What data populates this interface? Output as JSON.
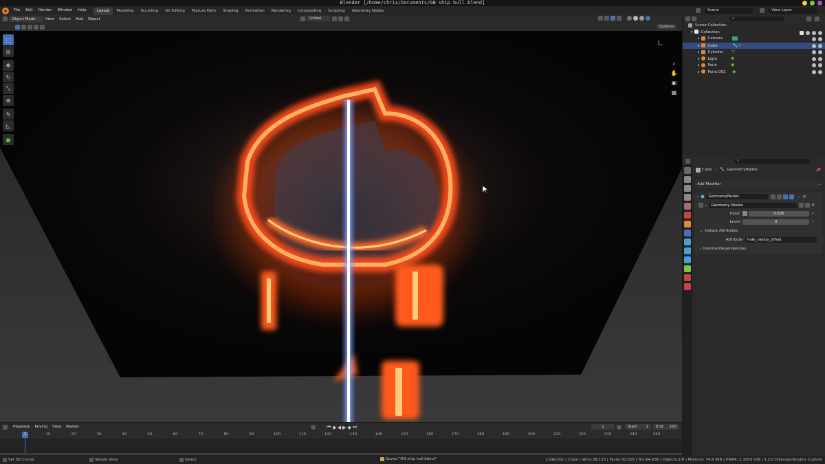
{
  "window": {
    "title": "Blender [/home/chris/Documents/GN ship hull.blend]"
  },
  "menu": {
    "items": [
      "File",
      "Edit",
      "Render",
      "Window",
      "Help"
    ]
  },
  "workspaces": [
    "Layout",
    "Modeling",
    "Sculpting",
    "UV Editing",
    "Texture Paint",
    "Shading",
    "Animation",
    "Rendering",
    "Compositing",
    "Scripting",
    "Geometry Nodes"
  ],
  "workspace_active": "Layout",
  "top_right": {
    "scene": "Scene",
    "view_layer": "View Layer"
  },
  "viewport_header": {
    "mode": "Object Mode",
    "menus": [
      "View",
      "Select",
      "Add",
      "Object"
    ],
    "orientation": "Global",
    "options": "Options"
  },
  "timeline": {
    "menus": [
      "Playback",
      "Keying",
      "View",
      "Marker"
    ],
    "current_frame": "1",
    "start_label": "Start",
    "start": "1",
    "end_label": "End",
    "end": "250",
    "playhead": "1",
    "ticks": [
      "10",
      "20",
      "30",
      "40",
      "50",
      "60",
      "70",
      "80",
      "90",
      "100",
      "110",
      "120",
      "130",
      "140",
      "150",
      "160",
      "170",
      "180",
      "190",
      "200",
      "210",
      "220",
      "230",
      "240",
      "250"
    ]
  },
  "status": {
    "left1": "Set 3D Cursor",
    "left2": "Rotate View",
    "left3": "Select",
    "message": "Saved \"GN ship hull.blend\"",
    "stats": "Collection | Cube | Verts:38,120 | Faces:30,526 | Tris:64,636 | Objects:1/6 | Memory: 74.8 MiB | VRAM: 2.3/8.0 GiB | 3.3.0 DillongooStudios Custom"
  },
  "outliner": {
    "scene_collection": "Scene Collection",
    "collection": "Collection",
    "items": [
      {
        "name": "Camera",
        "color": "#e0873a"
      },
      {
        "name": "Cube",
        "color": "#e0873a",
        "selected": true
      },
      {
        "name": "Cylinder",
        "color": "#e0873a"
      },
      {
        "name": "Light",
        "color": "#e0873a"
      },
      {
        "name": "Point",
        "color": "#e0873a"
      },
      {
        "name": "Point.001",
        "color": "#e0873a"
      }
    ]
  },
  "properties": {
    "breadcrumb_object": "Cube",
    "breadcrumb_modifier": "GeometryNodes",
    "add_modifier": "Add Modifier",
    "modifier_name": "GeometryNodes",
    "node_group": "Geometry Nodes",
    "input_label": "Input",
    "input_value": "0.635",
    "level_label": "Level",
    "level_value": "0",
    "output_attributes": "Output Attributes",
    "attribute_label": "Attribute",
    "attribute_value": "hole_radius_offset",
    "internal_dependencies": "Internal Dependencies"
  },
  "colors": {
    "accent": "#4772b3",
    "selection": "#334d80",
    "fire": "#ff5a1f",
    "beam": "#8fb0ff"
  }
}
